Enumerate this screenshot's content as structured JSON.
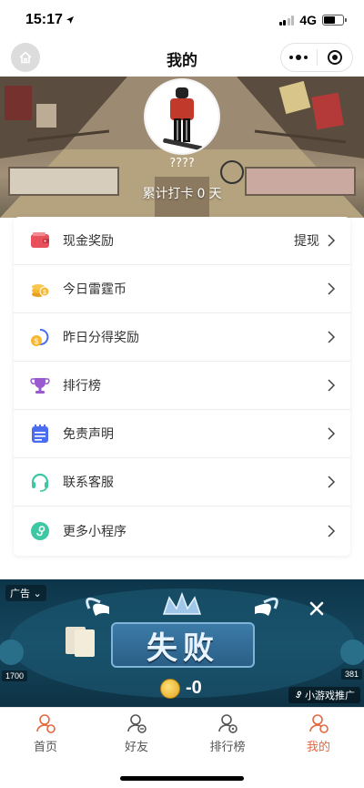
{
  "status_bar": {
    "time": "15:17",
    "network": "4G"
  },
  "nav": {
    "title": "我的"
  },
  "profile": {
    "username": "????",
    "checkin_prefix": "累计打卡",
    "checkin_days": "0",
    "checkin_suffix": "天"
  },
  "menu": {
    "items": [
      {
        "label": "现金奖励",
        "extra": "提现",
        "icon": "wallet-icon",
        "color": "#e8505b"
      },
      {
        "label": "今日雷霆币",
        "extra": "",
        "icon": "coins-icon",
        "color": "#f5b82e"
      },
      {
        "label": "昨日分得奖励",
        "extra": "",
        "icon": "reward-icon",
        "color": "#f5b82e"
      },
      {
        "label": "排行榜",
        "extra": "",
        "icon": "trophy-icon",
        "color": "#9b59d0"
      },
      {
        "label": "免责声明",
        "extra": "",
        "icon": "notepad-icon",
        "color": "#4a6cf0"
      },
      {
        "label": "联系客服",
        "extra": "",
        "icon": "headset-icon",
        "color": "#3ec7a3"
      },
      {
        "label": "更多小程序",
        "extra": "",
        "icon": "miniprogram-icon",
        "color": "#3ec7a3"
      }
    ]
  },
  "ad": {
    "tag": "广告",
    "headline": "失败",
    "score": "-0",
    "promo": "小游戏推广",
    "left_chip": "1700",
    "right_chip": "381"
  },
  "tabs": [
    {
      "label": "首页",
      "icon": "home-person-icon",
      "active": false
    },
    {
      "label": "好友",
      "icon": "friends-icon",
      "active": false
    },
    {
      "label": "排行榜",
      "icon": "ranking-icon",
      "active": false
    },
    {
      "label": "我的",
      "icon": "profile-icon",
      "active": true
    }
  ],
  "colors": {
    "accent": "#e2673f",
    "ad_bg": "#15465e"
  }
}
